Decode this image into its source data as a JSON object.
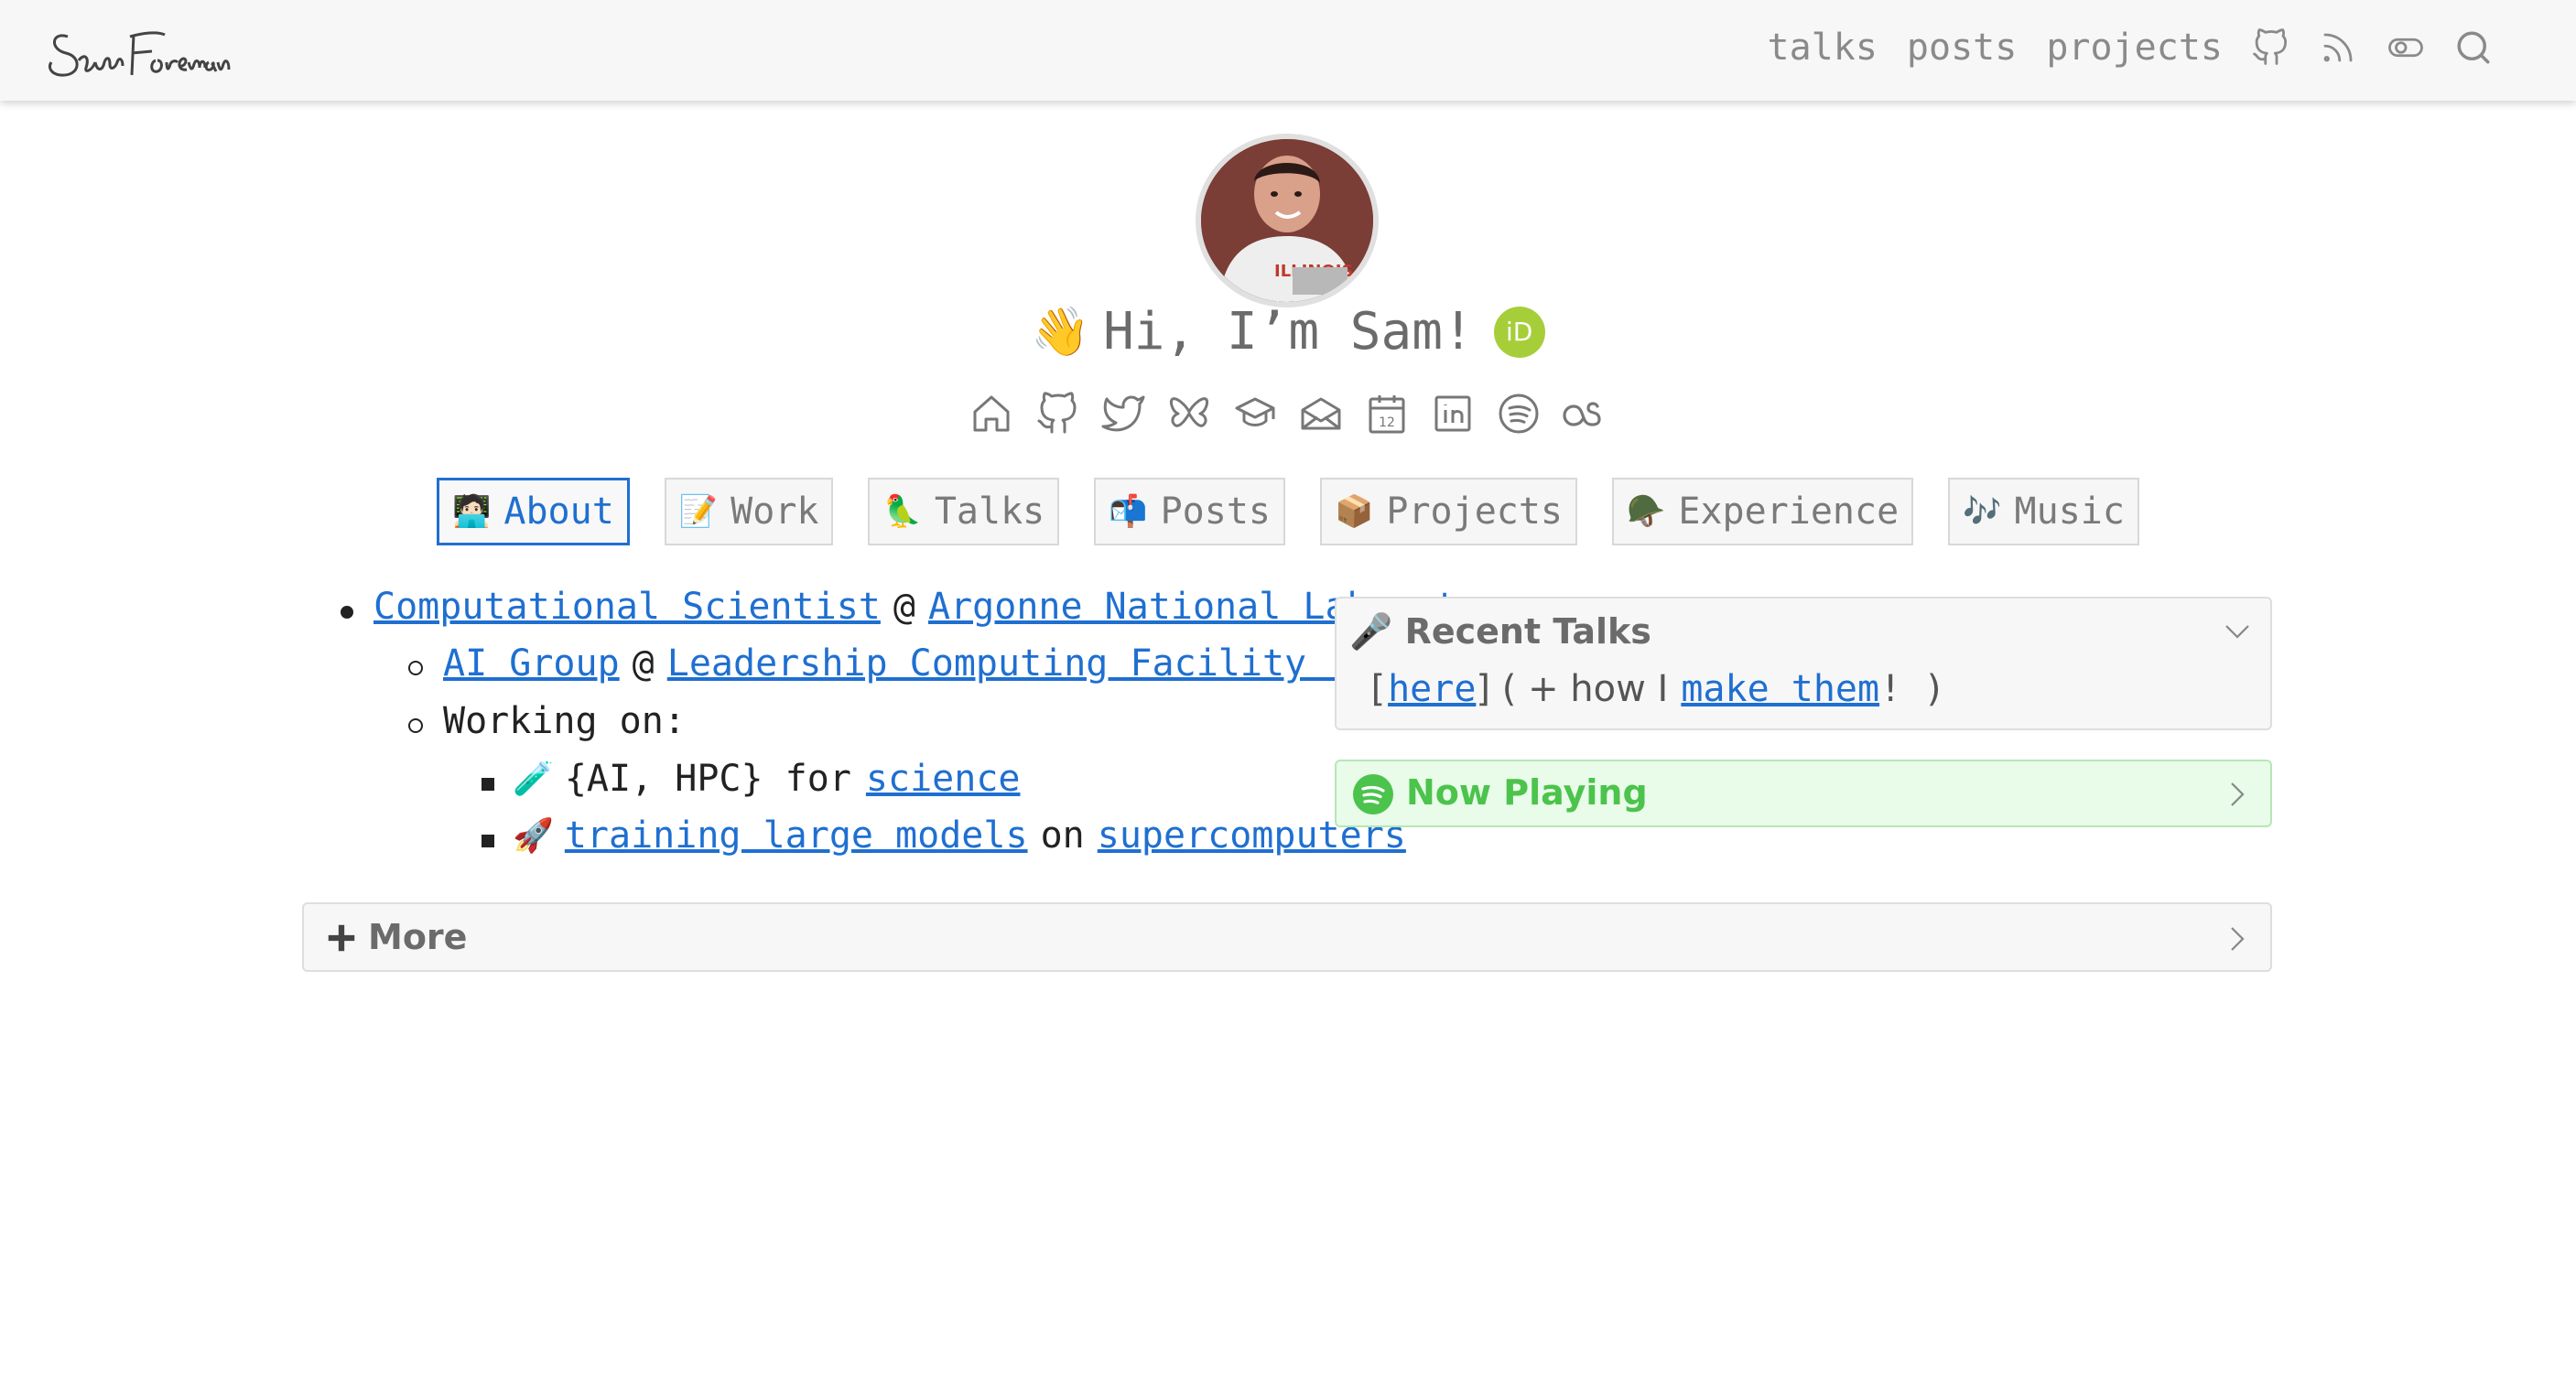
{
  "navbar": {
    "logo_text": "Sam Foreman",
    "links": [
      "talks",
      "posts",
      "projects"
    ],
    "icons": [
      "github-icon",
      "rss-icon",
      "toggle-icon",
      "search-icon"
    ]
  },
  "profile": {
    "greeting_emoji": "👋",
    "greeting": "Hi, I’m Sam!",
    "orcid_label": "iD",
    "social_icons": [
      "home-icon",
      "github-icon",
      "twitter-icon",
      "bluesky-icon",
      "scholar-icon",
      "email-icon",
      "calendar-icon",
      "linkedin-icon",
      "spotify-icon",
      "lastfm-icon"
    ],
    "calendar_day": "12"
  },
  "tabs": [
    {
      "emoji": "🧑🏻‍💻",
      "label": "About",
      "active": true
    },
    {
      "emoji": "📝",
      "label": "Work",
      "active": false
    },
    {
      "emoji": "🦜",
      "label": "Talks",
      "active": false
    },
    {
      "emoji": "📬",
      "label": "Posts",
      "active": false
    },
    {
      "emoji": "📦",
      "label": "Projects",
      "active": false
    },
    {
      "emoji": "🪖",
      "label": "Experience",
      "active": false
    },
    {
      "emoji": "🎶",
      "label": "Music",
      "active": false
    }
  ],
  "about": {
    "role": "Computational Scientist",
    "at": "@",
    "org": "Argonne National Laboratory",
    "group": "AI Group",
    "facility": "Leadership Computing Facility (ALCF)",
    "working_on": "Working on:",
    "item1_emoji": "🧪",
    "item1_text": "{AI, HPC} for",
    "item1_link": "science",
    "item2_emoji": "🚀",
    "item2_link1": "training large models",
    "item2_mid": "on",
    "item2_link2": "supercomputers"
  },
  "recent_talks": {
    "emoji": "🎤",
    "title": "Recent Talks",
    "open_bracket": "[",
    "here": "here",
    "close_text": "] ( + how I",
    "make_them": "make them",
    "end": "! )"
  },
  "now_playing": {
    "title": "Now Playing"
  },
  "more": {
    "title": "More"
  }
}
